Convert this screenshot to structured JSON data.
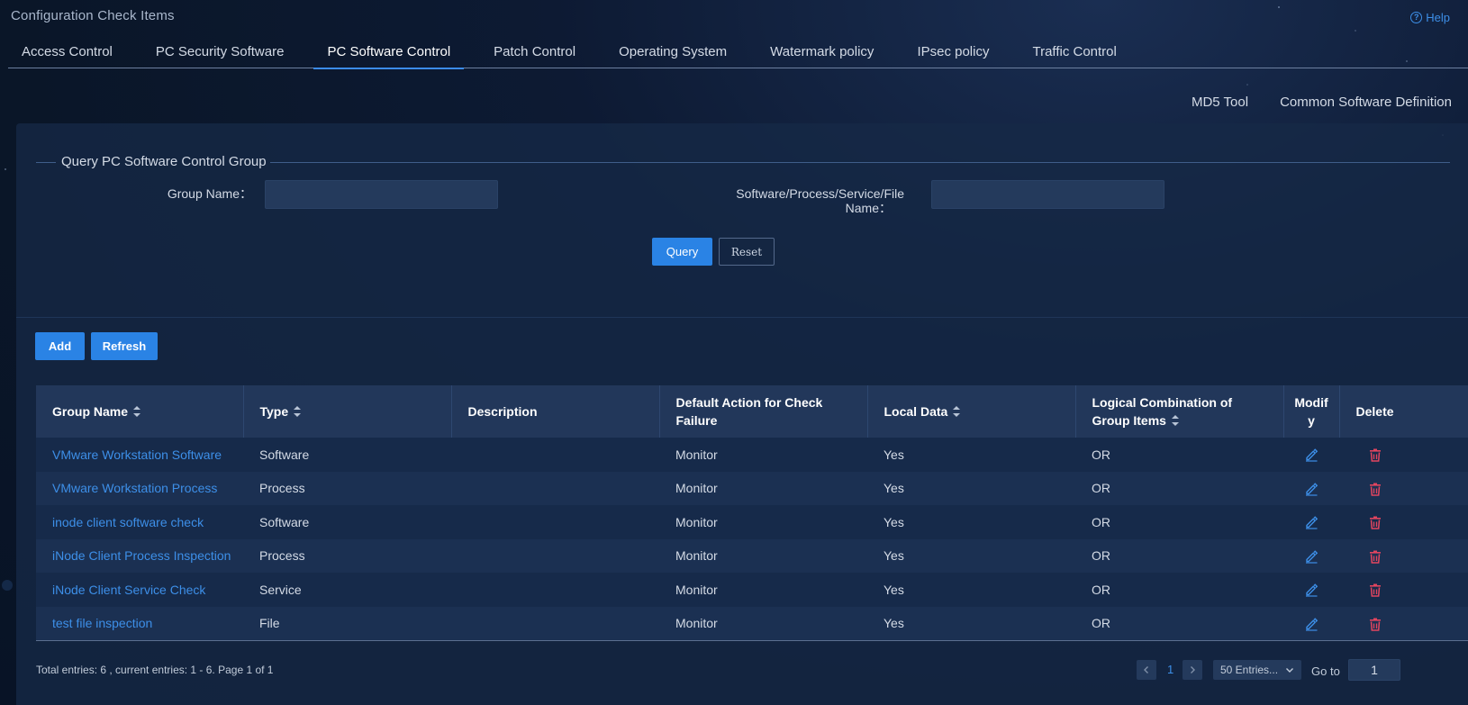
{
  "page": {
    "title": "Configuration Check Items",
    "help_label": "Help"
  },
  "tabs": [
    {
      "label": "Access Control"
    },
    {
      "label": "PC Security Software"
    },
    {
      "label": "PC Software Control",
      "active": true
    },
    {
      "label": "Patch Control"
    },
    {
      "label": "Operating System"
    },
    {
      "label": "Watermark policy"
    },
    {
      "label": "IPsec policy"
    },
    {
      "label": "Traffic Control"
    }
  ],
  "top_links": {
    "md5_tool": "MD5 Tool",
    "common_software": "Common Software Definition"
  },
  "query": {
    "legend": "Query PC Software Control Group",
    "group_name_label": "Group Name：",
    "group_name_value": "",
    "spsf_label_line1": "Software/Process/Service/File",
    "spsf_label_line2": "Name：",
    "spsf_value": "",
    "query_button": "Query",
    "reset_button": "Reset"
  },
  "toolbar": {
    "add_button": "Add",
    "refresh_button": "Refresh"
  },
  "table": {
    "columns": [
      {
        "label": "Group Name",
        "sortable": true
      },
      {
        "label": "Type",
        "sortable": true
      },
      {
        "label": "Description",
        "sortable": false
      },
      {
        "label": "Default Action for Check Failure",
        "sortable": false
      },
      {
        "label": "Local Data",
        "sortable": true
      },
      {
        "label": "Logical Combination of Group Items",
        "sortable": true
      },
      {
        "label_line1": "Modif",
        "label_line2": "y",
        "sortable": false
      },
      {
        "label": "Delete",
        "sortable": false
      }
    ],
    "rows": [
      {
        "group_name": "VMware Workstation Software",
        "type": "Software",
        "description": "",
        "action": "Monitor",
        "local": "Yes",
        "logic": "OR"
      },
      {
        "group_name": "VMware Workstation Process",
        "type": "Process",
        "description": "",
        "action": "Monitor",
        "local": "Yes",
        "logic": "OR"
      },
      {
        "group_name": "inode client software check",
        "type": "Software",
        "description": "",
        "action": "Monitor",
        "local": "Yes",
        "logic": "OR"
      },
      {
        "group_name": "iNode Client Process Inspection",
        "type": "Process",
        "description": "",
        "action": "Monitor",
        "local": "Yes",
        "logic": "OR"
      },
      {
        "group_name": "iNode Client Service Check",
        "type": "Service",
        "description": "",
        "action": "Monitor",
        "local": "Yes",
        "logic": "OR"
      },
      {
        "group_name": "test file inspection",
        "type": "File",
        "description": "",
        "action": "Monitor",
        "local": "Yes",
        "logic": "OR"
      }
    ]
  },
  "pagination": {
    "summary": "Total entries: 6 , current entries: 1 - 6. Page 1 of 1",
    "current_page": "1",
    "page_size": "50 Entries...",
    "goto_label": "Go to",
    "goto_value": "1"
  },
  "colors": {
    "accent": "#2a83e5",
    "link": "#3d8fe8",
    "delete": "#e2455f"
  },
  "icons": {
    "help": "help-icon",
    "sort": "sort-icon",
    "modify": "edit-icon",
    "delete": "trash-icon",
    "prev": "chevron-left-icon",
    "next": "chevron-right-icon",
    "dropdown": "chevron-down-icon"
  }
}
